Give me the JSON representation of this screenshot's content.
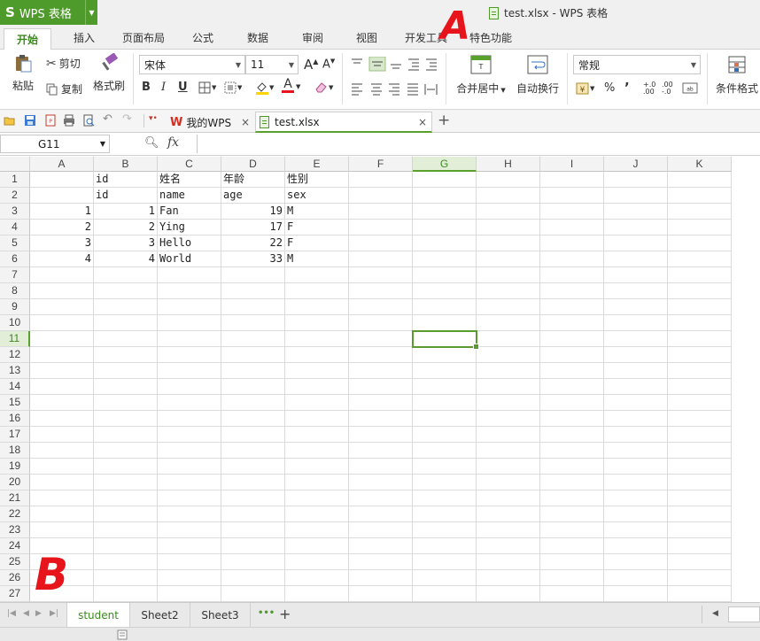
{
  "title_bar": {
    "app_logo_letter": "S",
    "app_name": "WPS 表格",
    "doc_title": "test.xlsx - WPS 表格"
  },
  "menu": {
    "tabs": [
      "开始",
      "插入",
      "页面布局",
      "公式",
      "数据",
      "审阅",
      "视图",
      "开发工具",
      "特色功能"
    ],
    "active": "开始"
  },
  "ribbon": {
    "paste": "粘贴",
    "cut": "剪切",
    "copy": "复制",
    "format_painter": "格式刷",
    "font_name": "宋体",
    "font_size": "11",
    "bold": "B",
    "italic": "I",
    "underline": "U",
    "merge_center": "合并居中",
    "wrap_text": "自动换行",
    "number_format": "常规",
    "percent": "%",
    "comma": "’",
    "conditional_format": "条件格式"
  },
  "doc_tabs": {
    "my_wps": "我的WPS",
    "file": "test.xlsx",
    "close_glyph": "×",
    "new_glyph": "+"
  },
  "formula_bar": {
    "name_box": "G11",
    "fx_label": "fx",
    "formula": ""
  },
  "grid": {
    "columns": [
      "A",
      "B",
      "C",
      "D",
      "E",
      "F",
      "G",
      "H",
      "I",
      "J",
      "K"
    ],
    "selected_column": "G",
    "selected_row": 11,
    "row_numbers": [
      "1",
      "2",
      "3",
      "4",
      "5",
      "6",
      "7",
      "8",
      "9",
      "10",
      "11",
      "12",
      "13",
      "14",
      "15",
      "16",
      "17",
      "18",
      "19",
      "20",
      "21",
      "22",
      "23",
      "24",
      "25",
      "26",
      "27"
    ],
    "cells": [
      {
        "ref": "B1",
        "value": "id"
      },
      {
        "ref": "C1",
        "value": "姓名"
      },
      {
        "ref": "D1",
        "value": "年龄"
      },
      {
        "ref": "E1",
        "value": "性别"
      },
      {
        "ref": "B2",
        "value": "id"
      },
      {
        "ref": "C2",
        "value": "name"
      },
      {
        "ref": "D2",
        "value": "age"
      },
      {
        "ref": "E2",
        "value": "sex"
      },
      {
        "ref": "A3",
        "value": "1",
        "num": true
      },
      {
        "ref": "B3",
        "value": "1",
        "num": true
      },
      {
        "ref": "C3",
        "value": "Fan"
      },
      {
        "ref": "D3",
        "value": "19",
        "num": true
      },
      {
        "ref": "E3",
        "value": "M"
      },
      {
        "ref": "A4",
        "value": "2",
        "num": true
      },
      {
        "ref": "B4",
        "value": "2",
        "num": true
      },
      {
        "ref": "C4",
        "value": "Ying"
      },
      {
        "ref": "D4",
        "value": "17",
        "num": true
      },
      {
        "ref": "E4",
        "value": "F"
      },
      {
        "ref": "A5",
        "value": "3",
        "num": true
      },
      {
        "ref": "B5",
        "value": "3",
        "num": true
      },
      {
        "ref": "C5",
        "value": "Hello"
      },
      {
        "ref": "D5",
        "value": "22",
        "num": true
      },
      {
        "ref": "E5",
        "value": "F"
      },
      {
        "ref": "A6",
        "value": "4",
        "num": true
      },
      {
        "ref": "B6",
        "value": "4",
        "num": true
      },
      {
        "ref": "C6",
        "value": "World"
      },
      {
        "ref": "D6",
        "value": "33",
        "num": true
      },
      {
        "ref": "E6",
        "value": "M"
      }
    ]
  },
  "sheets": {
    "tabs": [
      "student",
      "Sheet2",
      "Sheet3"
    ],
    "active": "student",
    "more_glyph": "•••",
    "add_glyph": "+"
  },
  "annotations": {
    "a": "A",
    "b": "B",
    "color": "#e8141b"
  },
  "colors": {
    "brand_green": "#4e9a2a",
    "selection_green": "#5a9a2e"
  }
}
